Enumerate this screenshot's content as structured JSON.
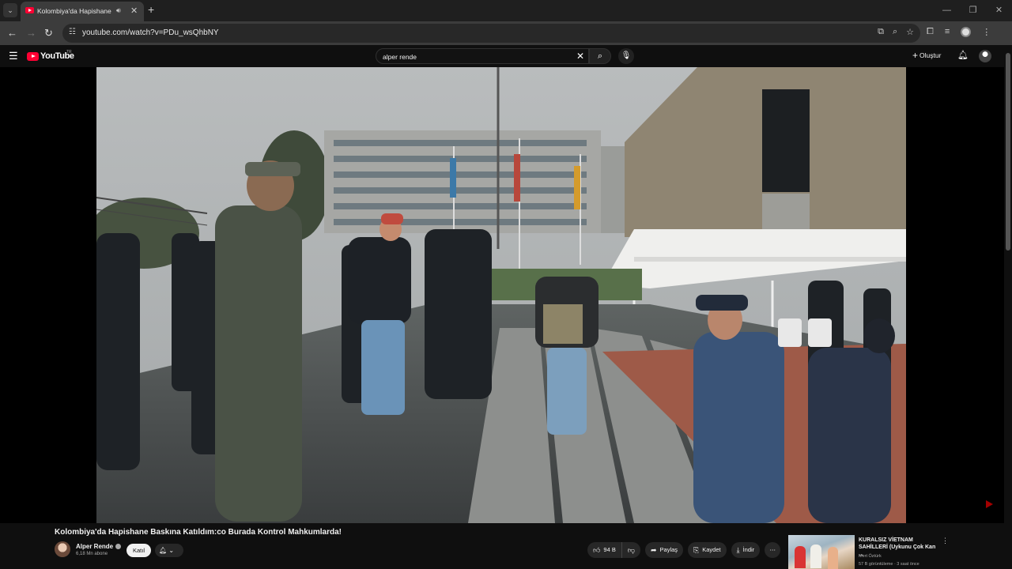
{
  "browser": {
    "tab_title": "Kolombiya'da Hapishane Baskına Katıldım",
    "url": "youtube.com/watch?v=PDu_wsQhbNY"
  },
  "youtube": {
    "logo_text": "YouTube",
    "region": "TR",
    "search_value": "alper rende",
    "create_label": "Oluştur"
  },
  "video": {
    "title": "Kolombiya'da Hapishane Baskına Katıldım:co Burada Kontrol Mahkumlarda!",
    "channel_name": "Alper Rende",
    "subscribers": "6,18 Mn abone",
    "join_label": "Katıl",
    "likes": "94 B",
    "share_label": "Paylaş",
    "save_label": "Kaydet",
    "download_label": "İndir"
  },
  "recommendation": {
    "title": "KURALSIZ VİETNAM SAHİLLERİ (Uykunu Çok Kan ...",
    "channel": "Mert Öztürk",
    "meta": "57 B görüntüleme · 3 saat önce"
  },
  "colors": {
    "brand_red": "#ff0033",
    "background": "#0f0f0f",
    "chip": "#272727"
  }
}
